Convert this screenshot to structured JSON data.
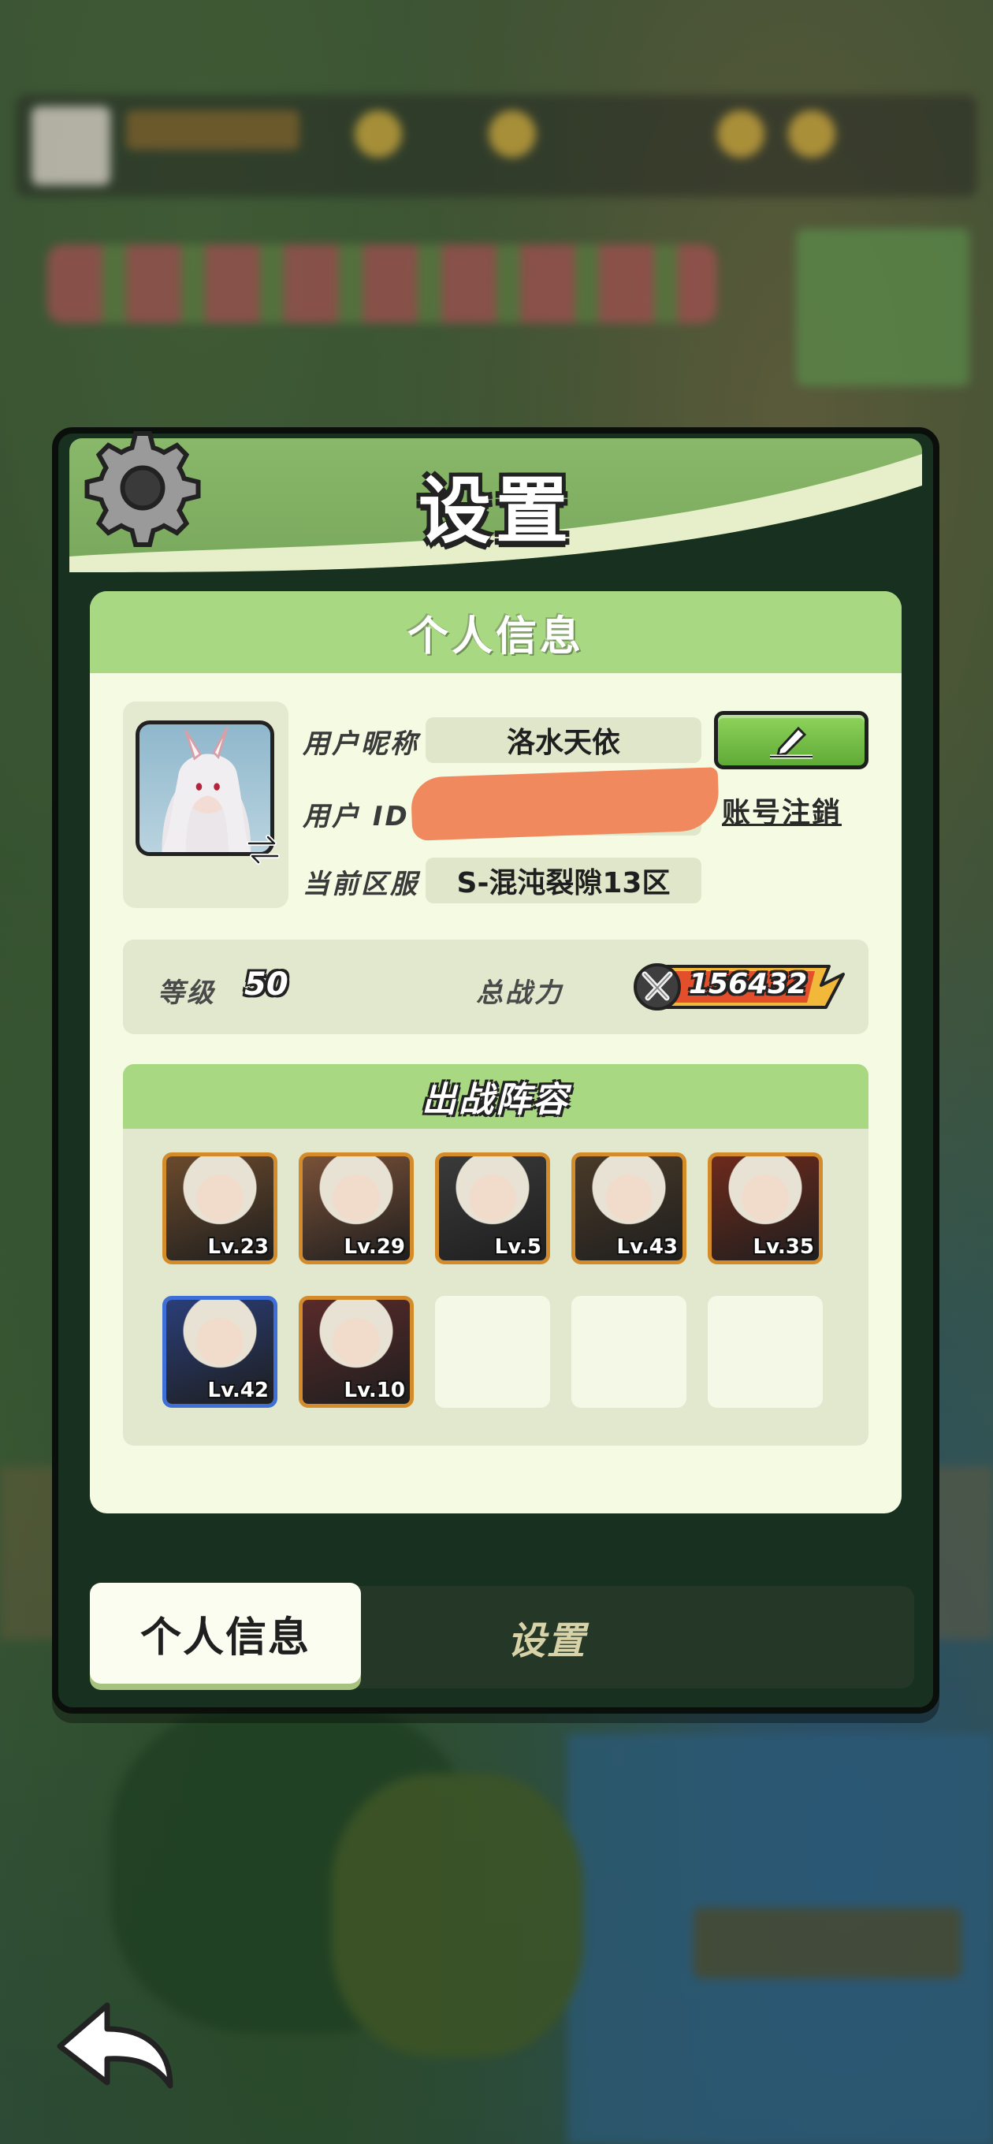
{
  "dialog": {
    "title": "设置"
  },
  "personal_info": {
    "section_title": "个人信息",
    "nickname_label": "用户昵称",
    "nickname_value": "洛水天依",
    "user_id_label": "用户  ID",
    "user_id_value": "",
    "server_label": "当前区服",
    "server_value": "S-混沌裂隙13区",
    "account_cancel_label": "账号注銷"
  },
  "stats": {
    "level_label": "等级",
    "level_value": "50",
    "power_label": "总战力",
    "power_value": "156432"
  },
  "lineup": {
    "title": "出战阵容",
    "heroes": [
      {
        "level": "Lv.23",
        "color": "#6b4a2c"
      },
      {
        "level": "Lv.29",
        "color": "#7a5138"
      },
      {
        "level": "Lv.5",
        "color": "#3a3a3a"
      },
      {
        "level": "Lv.43",
        "color": "#4a3a28"
      },
      {
        "level": "Lv.35",
        "color": "#6e2a1c"
      },
      {
        "level": "Lv.42",
        "color": "#2a3e78"
      },
      {
        "level": "Lv.10",
        "color": "#5a2a2a"
      }
    ],
    "empty_slots": 3
  },
  "tabs": {
    "active_label": "个人信息",
    "inactive_label": "设置"
  },
  "colors": {
    "header_green": "#8ab86a",
    "accent_green": "#a9d883",
    "edit_button_green": "#6fbd44",
    "hero_border_orange": "#d48c2a",
    "hero_border_blue": "#3e6fd6"
  },
  "icons": {
    "settings": "gear-icon",
    "edit": "pencil-icon",
    "swap": "swap-arrow-icon",
    "power": "crossed-swords-icon",
    "back": "back-arrow-icon"
  }
}
